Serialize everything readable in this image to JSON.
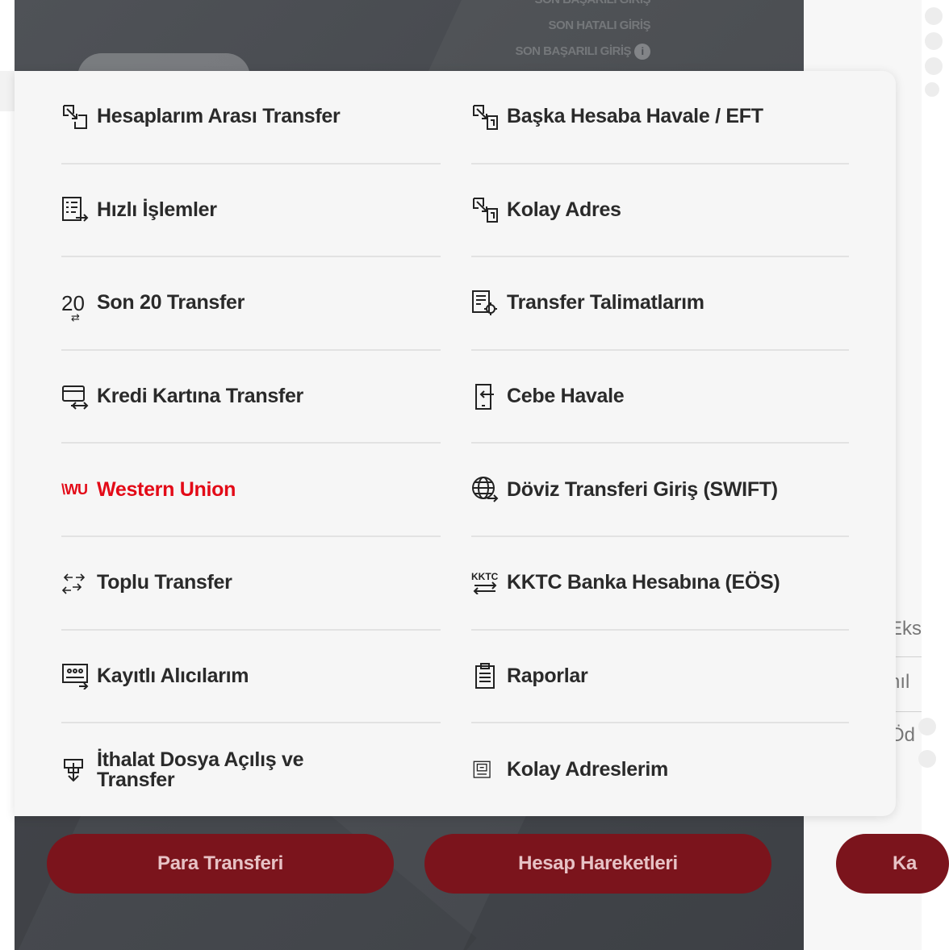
{
  "background": {
    "login_info": [
      "SON BAŞARILI GİRİŞ",
      "SON HATALI GİRİŞ",
      "SON BAŞARILI GİRİŞ"
    ],
    "info_icon": "i",
    "right_texts": [
      "Eks",
      "nıl",
      "Öd"
    ]
  },
  "menu": {
    "left": [
      {
        "label": "Hesaplarım Arası Transfer",
        "icon": "transfer-accounts-icon"
      },
      {
        "label": "Hızlı İşlemler",
        "icon": "quick-actions-icon"
      },
      {
        "label": "Son 20 Transfer",
        "icon": "last-20-icon",
        "icon_text": "20"
      },
      {
        "label": "Kredi Kartına Transfer",
        "icon": "credit-card-transfer-icon"
      },
      {
        "label": "Western Union",
        "icon": "western-union-logo",
        "icon_text": "WU"
      },
      {
        "label": "Toplu Transfer",
        "icon": "bulk-transfer-icon"
      },
      {
        "label": "Kayıtlı Alıcılarım",
        "icon": "saved-recipients-icon"
      },
      {
        "label": "İthalat Dosya Açılış ve Transfer",
        "icon": "import-file-icon"
      }
    ],
    "right": [
      {
        "label": "Başka Hesaba Havale / EFT",
        "icon": "other-account-transfer-icon"
      },
      {
        "label": "Kolay Adres",
        "icon": "easy-address-icon"
      },
      {
        "label": "Transfer Talimatlarım",
        "icon": "transfer-instructions-icon"
      },
      {
        "label": "Cebe Havale",
        "icon": "mobile-transfer-icon"
      },
      {
        "label": "Döviz Transferi Giriş (SWIFT)",
        "icon": "globe-icon"
      },
      {
        "label": "KKTC Banka Hesabına (EÖS)",
        "icon": "kktc-icon",
        "icon_text": "KKTC"
      },
      {
        "label": "Raporlar",
        "icon": "clipboard-icon"
      },
      {
        "label": "Kolay Adreslerim",
        "icon": "easy-addresses-list-icon"
      }
    ]
  },
  "buttons": {
    "para_transferi": "Para Transferi",
    "hesap_hareketleri": "Hesap Hareketleri",
    "third": "Ka"
  },
  "colors": {
    "accent_red": "#e30a17",
    "button_bg": "#7b141c",
    "menu_bg": "#f6f6f6"
  }
}
